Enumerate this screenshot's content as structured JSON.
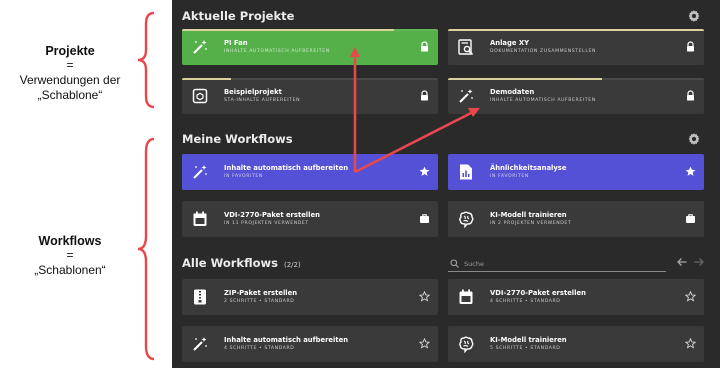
{
  "annotations": {
    "projects": {
      "title": "Projekte",
      "eq": "=",
      "line1": "Verwendungen der",
      "line2": "„Schablone“"
    },
    "workflows": {
      "title": "Workflows",
      "eq": "=",
      "line1": "„Schablonen“"
    }
  },
  "colors": {
    "annotation_red": "#e8484b",
    "green_card": "#56b04a",
    "purple_card": "#5551d6",
    "panel_bg": "#2a2a2a",
    "card_bg": "#3a3a3a"
  },
  "recent_projects": {
    "title": "Aktuelle Projekte",
    "cards": [
      {
        "title": "PI Fan",
        "subtitle": "INHALTE AUTOMATISCH AUFBEREITEN",
        "icon": "magic-wand-icon",
        "action": "lock-icon",
        "progress": 0.83
      },
      {
        "title": "Anlage XY",
        "subtitle": "DOKUMENTATION ZUSAMMENSTELLEN",
        "icon": "document-search-icon",
        "action": "lock-icon",
        "progress": 1.0
      },
      {
        "title": "Beispielprojekt",
        "subtitle": "STA-INHALTE AUFBEREITEN",
        "icon": "box-icon",
        "action": "lock-icon",
        "progress": 0.19
      },
      {
        "title": "Demodaten",
        "subtitle": "INHALTE AUTOMATISCH AUFBEREITEN",
        "icon": "magic-wand-icon",
        "action": "lock-icon",
        "progress": 0.6
      }
    ]
  },
  "my_workflows": {
    "title": "Meine Workflows",
    "cards": [
      {
        "title": "Inhalte automatisch aufbereiten",
        "subtitle": "IN FAVORITEN",
        "icon": "magic-wand-icon",
        "action": "star-filled-icon"
      },
      {
        "title": "Ähnlichkeitsanalyse",
        "subtitle": "IN FAVORITEN",
        "icon": "chart-document-icon",
        "action": "star-filled-icon"
      },
      {
        "title": "VDI-2770-Paket erstellen",
        "subtitle": "IN 11 PROJEKTEN VERWENDET",
        "icon": "calendar-icon",
        "action": "briefcase-icon"
      },
      {
        "title": "KI-Modell trainieren",
        "subtitle": "IN 2 PROJEKTEN VERWENDET",
        "icon": "brain-icon",
        "action": "briefcase-icon"
      }
    ]
  },
  "all_workflows": {
    "title": "Alle Workflows",
    "count": "(2/2)",
    "search_placeholder": "Suche",
    "cards": [
      {
        "title": "ZIP-Paket erstellen",
        "subtitle": "2 SCHRITTE • STANDARD",
        "icon": "zip-file-icon",
        "action": "star-outline-icon"
      },
      {
        "title": "VDI-2770-Paket erstellen",
        "subtitle": "4 SCHRITTE • STANDARD",
        "icon": "calendar-icon",
        "action": "star-outline-icon"
      },
      {
        "title": "Inhalte automatisch aufbereiten",
        "subtitle": "4 SCHRITTE • STANDARD",
        "icon": "magic-wand-icon",
        "action": "star-outline-icon"
      },
      {
        "title": "KI-Modell trainieren",
        "subtitle": "5 SCHRITTE • STANDARD",
        "icon": "brain-icon",
        "action": "star-outline-icon"
      }
    ]
  }
}
